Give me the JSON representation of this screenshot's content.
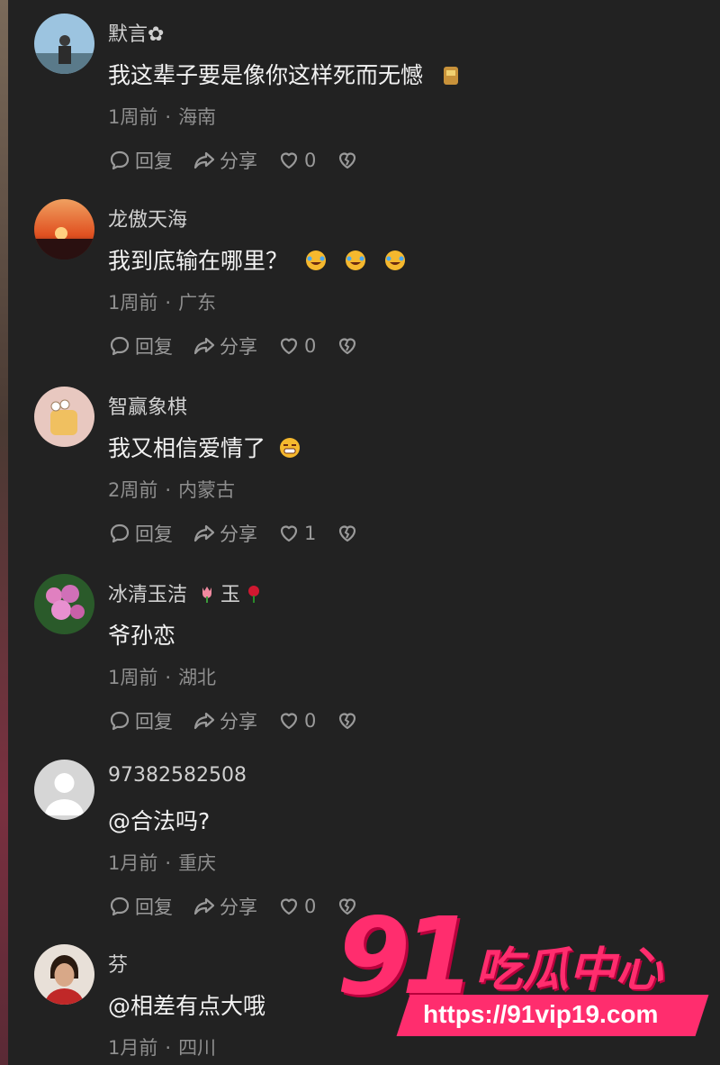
{
  "comments": [
    {
      "username": "默言✿",
      "text": "我这辈子要是像你这样死而无憾",
      "time": "1周前",
      "location": "海南",
      "reply_label": "回复",
      "share_label": "分享",
      "likes": "0"
    },
    {
      "username": "龙傲天海",
      "text": "我到底输在哪里？",
      "time": "1周前",
      "location": "广东",
      "reply_label": "回复",
      "share_label": "分享",
      "likes": "0"
    },
    {
      "username": "智赢象棋",
      "text": "我又相信爱情了",
      "time": "2周前",
      "location": "内蒙古",
      "reply_label": "回复",
      "share_label": "分享",
      "likes": "1"
    },
    {
      "username_part1": "冰清玉洁",
      "username_part2": "玉",
      "text": "爷孙恋",
      "time": "1周前",
      "location": "湖北",
      "reply_label": "回复",
      "share_label": "分享",
      "likes": "0"
    },
    {
      "username": "97382582508",
      "text": "@合法吗?",
      "time": "1月前",
      "location": "重庆",
      "reply_label": "回复",
      "share_label": "分享",
      "likes": "0"
    },
    {
      "username": "芬",
      "text": "@相差有点大哦",
      "time": "1月前",
      "location": "四川"
    }
  ],
  "separator": "·",
  "watermark": {
    "number": "91",
    "brand": "吃瓜中心",
    "url": "https://91vip19.com"
  },
  "colors": {
    "background": "#222222",
    "watermark": "#ff2d6e"
  }
}
